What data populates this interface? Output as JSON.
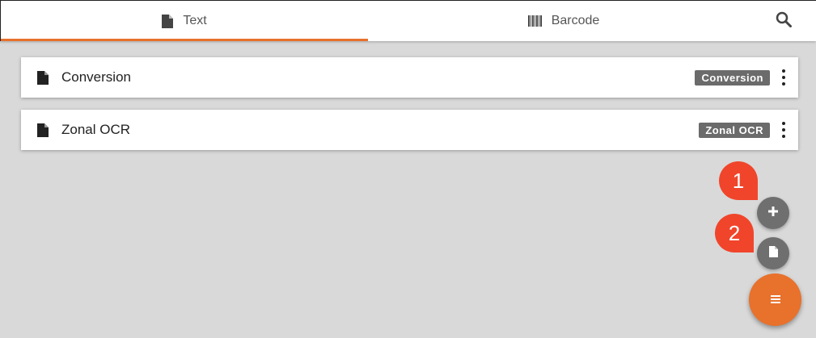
{
  "tabs": {
    "text": {
      "label": "Text",
      "icon": "document-icon"
    },
    "barcode": {
      "label": "Barcode",
      "icon": "barcode-icon"
    }
  },
  "toolbar": {
    "search_icon": "search-icon"
  },
  "items": [
    {
      "title": "Conversion",
      "badge": "Conversion"
    },
    {
      "title": "Zonal OCR",
      "badge": "Zonal OCR"
    }
  ],
  "callouts": [
    "1",
    "2"
  ],
  "colors": {
    "accent": "#e8712c",
    "callout": "#f0452b",
    "badge": "#6b6b6b"
  }
}
